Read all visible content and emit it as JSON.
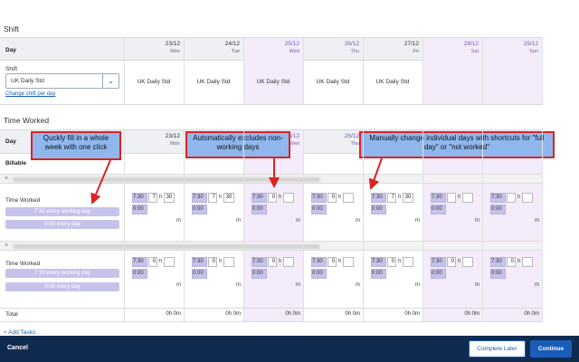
{
  "shift": {
    "title": "Shift",
    "day_label": "Day",
    "shift_label": "Shift",
    "select_value": "UK Daily Std",
    "change_link": "Change shift per day",
    "cells": [
      "UK Daily Std",
      "UK Daily Std",
      "UK Daily Std",
      "UK Daily Std",
      "UK Daily Std",
      "",
      ""
    ]
  },
  "days": [
    {
      "date": "23/12",
      "weekday": "Mon"
    },
    {
      "date": "24/12",
      "weekday": "Tue"
    },
    {
      "date": "25/12",
      "weekday": "Wed"
    },
    {
      "date": "26/12",
      "weekday": "Thu"
    },
    {
      "date": "27/12",
      "weekday": "Fri"
    },
    {
      "date": "28/12",
      "weekday": "Sat"
    },
    {
      "date": "29/12",
      "weekday": "Sun"
    }
  ],
  "time_worked": {
    "title": "Time Worked",
    "day_label": "Day",
    "billable_label": "Billable",
    "row_label": "Time Worked",
    "fill_working_day": "7:30 every working day",
    "fill_every_day": "0:00 every day",
    "rows": [
      {
        "entries": [
          {
            "shortcut": "7:30",
            "h": "7",
            "m": "30"
          },
          {
            "shortcut": "7:30",
            "h": "7",
            "m": "30"
          },
          {
            "shortcut": "7:30",
            "h": "0",
            "m": ""
          },
          {
            "shortcut": "7:30",
            "h": "0",
            "m": ""
          },
          {
            "shortcut": "7:30",
            "h": "7",
            "m": "30"
          },
          {
            "shortcut": "7:30",
            "h": "",
            "m": ""
          },
          {
            "shortcut": "7:30",
            "h": "",
            "m": ""
          }
        ]
      },
      {
        "entries": [
          {
            "shortcut": "7:30",
            "h": "0",
            "m": ""
          },
          {
            "shortcut": "7:30",
            "h": "0",
            "m": ""
          },
          {
            "shortcut": "7:30",
            "h": "0",
            "m": ""
          },
          {
            "shortcut": "7:30",
            "h": "0",
            "m": ""
          },
          {
            "shortcut": "7:30",
            "h": "0",
            "m": ""
          },
          {
            "shortcut": "7:30",
            "h": "0",
            "m": ""
          },
          {
            "shortcut": "7:30",
            "h": "0",
            "m": ""
          }
        ]
      }
    ],
    "zero_shortcut": "0:00",
    "unit_h": "h",
    "unit_m": "m",
    "total_label": "Total",
    "totals": [
      "0h 0m",
      "0h 0m",
      "0h 0m",
      "0h 0m",
      "0h 0m",
      "0h 0m",
      "0h 0m"
    ],
    "add_tasks": "+ Add Tasks"
  },
  "footer": {
    "cancel": "Cancel",
    "complete_later": "Complete Later",
    "continue": "Continue"
  },
  "callouts": {
    "fill_week": "Quckly fill in a whole week with one click",
    "exclude_days": "Automatically excludes non-working days",
    "manual_change": "Manually change individual days with shortcuts for \"full day\" or \"not worked\""
  },
  "colors": {
    "weekend_bg": "#f4ecfb",
    "highlight": "#c6c3ea",
    "primary": "#1a5db8",
    "footer_bg": "#112b50",
    "callout_bg": "#8fb7ee",
    "callout_border": "#dd2222"
  }
}
